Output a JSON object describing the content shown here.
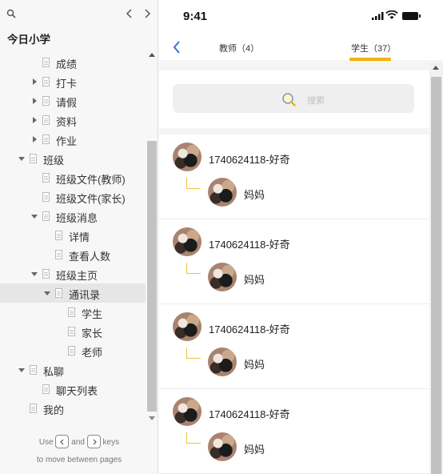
{
  "sidebar": {
    "title": "今日小学",
    "tree": [
      {
        "label": "成绩",
        "depth": 2,
        "expander": "none",
        "selected": false
      },
      {
        "label": "打卡",
        "depth": 2,
        "expander": "collapsed",
        "selected": false
      },
      {
        "label": "请假",
        "depth": 2,
        "expander": "collapsed",
        "selected": false
      },
      {
        "label": "资料",
        "depth": 2,
        "expander": "collapsed",
        "selected": false
      },
      {
        "label": "作业",
        "depth": 2,
        "expander": "collapsed",
        "selected": false
      },
      {
        "label": "班级",
        "depth": 1,
        "expander": "expanded",
        "selected": false
      },
      {
        "label": "班级文件(教师)",
        "depth": 2,
        "expander": "none",
        "selected": false
      },
      {
        "label": "班级文件(家长)",
        "depth": 2,
        "expander": "none",
        "selected": false
      },
      {
        "label": "班级消息",
        "depth": 2,
        "expander": "expanded",
        "selected": false
      },
      {
        "label": "详情",
        "depth": 3,
        "expander": "none",
        "selected": false
      },
      {
        "label": "查看人数",
        "depth": 3,
        "expander": "none",
        "selected": false
      },
      {
        "label": "班级主页",
        "depth": 2,
        "expander": "expanded",
        "selected": false
      },
      {
        "label": "通讯录",
        "depth": 3,
        "expander": "expanded",
        "selected": true
      },
      {
        "label": "学生",
        "depth": 4,
        "expander": "none",
        "selected": false
      },
      {
        "label": "家长",
        "depth": 4,
        "expander": "none",
        "selected": false
      },
      {
        "label": "老师",
        "depth": 4,
        "expander": "none",
        "selected": false
      },
      {
        "label": "私聊",
        "depth": 1,
        "expander": "expanded",
        "selected": false
      },
      {
        "label": "聊天列表",
        "depth": 2,
        "expander": "none",
        "selected": false
      },
      {
        "label": "我的",
        "depth": 1,
        "expander": "none",
        "selected": false
      }
    ],
    "hint": {
      "use": "Use",
      "and": "and",
      "keys": "keys",
      "line2": "to move between pages"
    }
  },
  "phone": {
    "status": {
      "time": "9:41"
    },
    "tabs": {
      "teachers": "教师（4）",
      "students": "学生（37）"
    },
    "search": {
      "placeholder": "搜索"
    },
    "contacts": [
      {
        "name": "1740624118-好奇",
        "relation": "妈妈"
      },
      {
        "name": "1740624118-好奇",
        "relation": "妈妈"
      },
      {
        "name": "1740624118-好奇",
        "relation": "妈妈"
      },
      {
        "name": "1740624118-好奇",
        "relation": "妈妈"
      }
    ]
  },
  "colors": {
    "accent": "#f5b301",
    "back_arrow": "#3a6fd8",
    "connector": "#f0c040"
  },
  "icons": [
    "search-icon",
    "chevron-left-icon",
    "chevron-right-icon",
    "page-icon",
    "expand-arrow-icon",
    "collapse-arrow-icon",
    "signal-icon",
    "wifi-icon",
    "battery-icon",
    "back-arrow-icon",
    "avatar"
  ]
}
